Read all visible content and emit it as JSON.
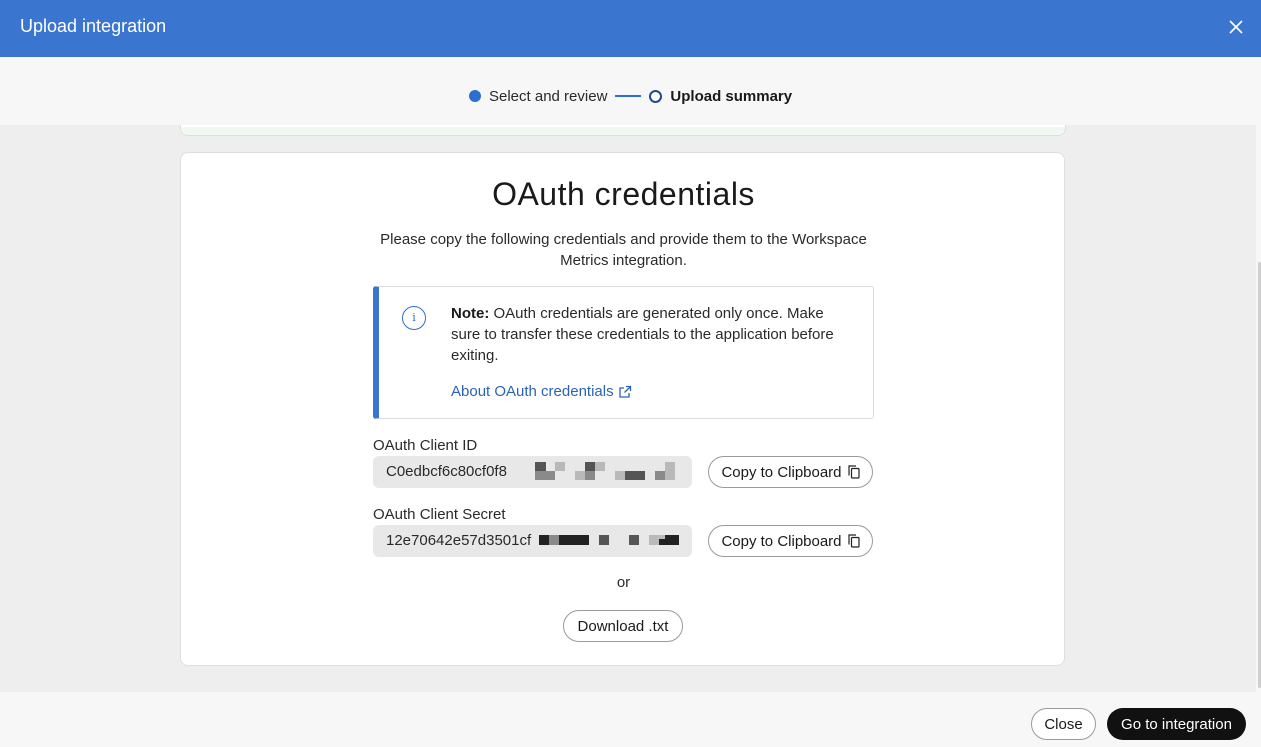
{
  "dialog": {
    "title": "Upload integration",
    "close_icon": "close-icon"
  },
  "stepper": {
    "steps": [
      {
        "label": "Select and review",
        "state": "completed"
      },
      {
        "label": "Upload summary",
        "state": "current"
      }
    ]
  },
  "card": {
    "title": "OAuth credentials",
    "description": "Please copy the following credentials and provide them to the Workspace Metrics integration."
  },
  "note": {
    "icon": "info-icon",
    "bold": "Note:",
    "text": " OAuth credentials are generated only once. Make sure to transfer these credentials to the application before exiting.",
    "link_label": "About OAuth credentials",
    "link_icon": "external-link-icon"
  },
  "client_id": {
    "label": "OAuth Client ID",
    "value": "C0edbcf6c80cf0f8",
    "copy_label": "Copy to Clipboard",
    "copy_icon": "copy-icon"
  },
  "client_secret": {
    "label": "OAuth Client Secret",
    "value": "12e70642e57d3501cf",
    "copy_label": "Copy to Clipboard",
    "copy_icon": "copy-icon"
  },
  "or_text": "or",
  "download_label": "Download .txt",
  "footer": {
    "close_label": "Close",
    "primary_label": "Go to integration"
  },
  "colors": {
    "header": "#3a76d0",
    "accent": "#2b6fd0",
    "primary_button": "#111111",
    "link": "#2a63b8"
  }
}
